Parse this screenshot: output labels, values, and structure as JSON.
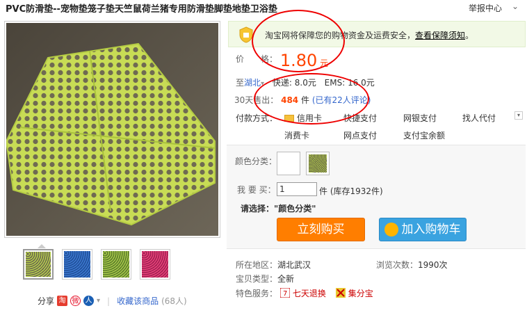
{
  "header": {
    "title": "PVC防滑垫--宠物垫笼子垫天竺鼠荷兰猪专用防滑垫脚垫地垫卫浴垫",
    "report_label": "举报中心",
    "report_arrow": "⌄"
  },
  "gallery": {
    "main_image_alt": "绿色PVC防滑垫",
    "thumbs": [
      {
        "name": "thumb-green",
        "color": "#b7d24a"
      },
      {
        "name": "thumb-blue",
        "color": "#3d78d0"
      },
      {
        "name": "thumb-green-2",
        "color": "#a8c94a"
      },
      {
        "name": "thumb-pink",
        "color": "#e8427b"
      }
    ]
  },
  "share": {
    "label": "分享",
    "taobao_icon": "淘",
    "weibo_icon": "微",
    "renren_icon": "人",
    "more_arrow": "▾",
    "favorite_label": "收藏该商品",
    "favorite_count": "(68人)"
  },
  "guarantee": {
    "text": "淘宝网将保障您的购物资金及运费安全，",
    "link": "查看保障须知",
    "end": "。"
  },
  "price": {
    "label": "价　　格：",
    "value": "1.80",
    "unit": "元"
  },
  "shipping": {
    "to_label": "至",
    "location": "湖北",
    "arrow": "▾",
    "express": "快递: 8.0元",
    "ems": "EMS: 16.0元"
  },
  "sales": {
    "label": "30天售出：",
    "count": "484",
    "unit": "件",
    "reviews": "(已有22人评论)"
  },
  "payment": {
    "label": "付款方式：",
    "methods": [
      "信用卡",
      "快捷支付",
      "网银支付",
      "找人代付",
      "消费卡",
      "网点支付",
      "支付宝余额"
    ],
    "toggle": "▾"
  },
  "buy": {
    "color_label": "颜色分类：",
    "qty_label": "我 要 买：",
    "qty_value": "1",
    "stock_text": "件 (库存1932件)",
    "prompt_label": "请选择：",
    "prompt_value": "\"颜色分类\"",
    "buy_now": "立刻购买",
    "add_cart": "加入购物车"
  },
  "details": {
    "location_label": "所在地区：",
    "location_value": "湖北武汉",
    "views_label": "浏览次数：",
    "views_value": "1990次",
    "type_label": "宝贝类型：",
    "type_value": "全新",
    "services_label": "特色服务：",
    "service_1": "七天退换",
    "service_2": "集分宝"
  },
  "colors": {
    "accent_orange": "#ff4400",
    "link_blue": "#3366cc",
    "annotation_red": "#ee0000"
  }
}
